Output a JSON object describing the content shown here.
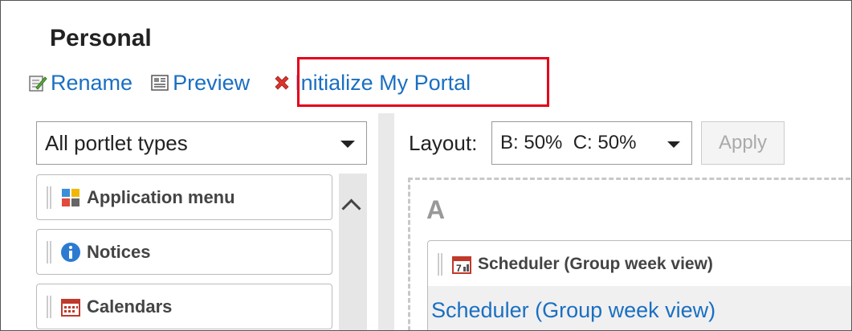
{
  "page": {
    "title": "Personal"
  },
  "toolbar": {
    "rename_label": "Rename",
    "preview_label": "Preview",
    "initialize_label": "Initialize My Portal"
  },
  "left_panel": {
    "filter_selected": "All portlet types",
    "items": [
      {
        "label": "Application menu",
        "icon": "app-menu-icon"
      },
      {
        "label": "Notices",
        "icon": "info-icon"
      },
      {
        "label": "Calendars",
        "icon": "calendar-icon"
      }
    ]
  },
  "right_panel": {
    "layout_label": "Layout:",
    "layout_selected": "B: 50%  C: 50%",
    "apply_label": "Apply",
    "zone_label": "A",
    "portlet": {
      "header": "Scheduler (Group week view)",
      "link": "Scheduler (Group week view)",
      "icon": "scheduler-icon"
    }
  },
  "colors": {
    "link": "#1a6fc2",
    "highlight": "#e3001b"
  }
}
